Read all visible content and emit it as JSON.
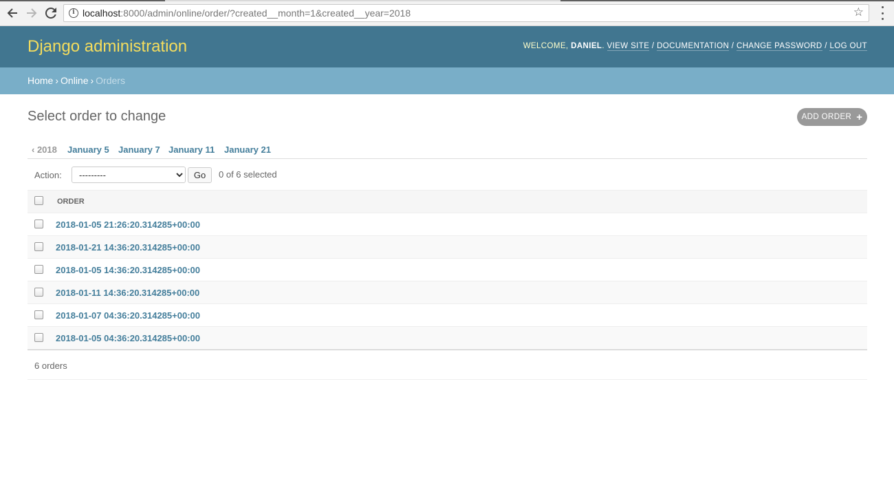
{
  "browser": {
    "url_host": "localhost",
    "url_rest": ":8000/admin/online/order/?created__month=1&created__year=2018"
  },
  "header": {
    "branding": "Django administration",
    "welcome": "Welcome, ",
    "username": "Daniel",
    "links": {
      "view_site": "View site",
      "documentation": "Documentation",
      "change_password": "Change password",
      "log_out": "Log out"
    }
  },
  "breadcrumbs": {
    "home": "Home",
    "app": "Online",
    "current": "Orders"
  },
  "content": {
    "title": "Select order to change",
    "add_button": "Add order"
  },
  "date_hierarchy": {
    "back": "‹ 2018",
    "days": [
      "January 5",
      "January 7",
      "January 11",
      "January 21"
    ]
  },
  "actions": {
    "label": "Action:",
    "selected_option": "---------",
    "go": "Go",
    "counter": "0 of 6 selected"
  },
  "table": {
    "column_header": "Order",
    "rows": [
      "2018-01-05 21:26:20.314285+00:00",
      "2018-01-21 14:36:20.314285+00:00",
      "2018-01-05 14:36:20.314285+00:00",
      "2018-01-11 14:36:20.314285+00:00",
      "2018-01-07 04:36:20.314285+00:00",
      "2018-01-05 04:36:20.314285+00:00"
    ]
  },
  "paginator": "6 orders",
  "colors": {
    "header_bg": "#417690",
    "breadcrumbs_bg": "#79aec8",
    "branding": "#f5dd5d",
    "link": "#447e9b"
  }
}
